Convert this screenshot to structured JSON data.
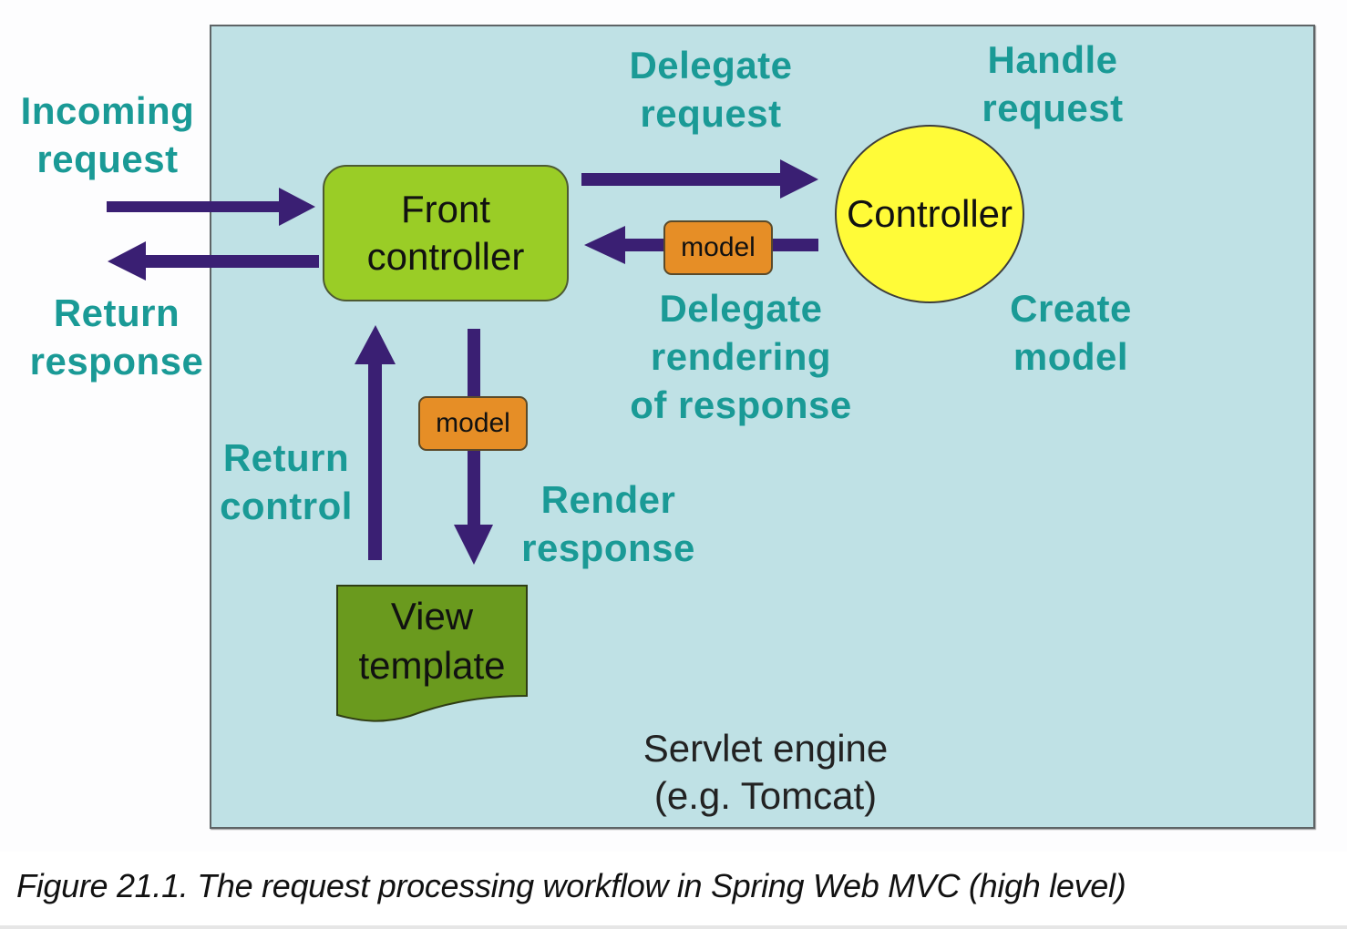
{
  "diagram": {
    "container": {
      "label_line1": "Servlet engine",
      "label_line2": "(e.g. Tomcat)"
    },
    "nodes": {
      "front_controller": {
        "line1": "Front",
        "line2": "controller"
      },
      "controller": {
        "label": "Controller"
      },
      "view_template": {
        "line1": "View",
        "line2": "template"
      },
      "model_badge_horizontal": {
        "label": "model"
      },
      "model_badge_vertical": {
        "label": "model"
      }
    },
    "labels": {
      "incoming_request": {
        "line1": "Incoming",
        "line2": "request"
      },
      "return_response": {
        "line1": "Return",
        "line2": "response"
      },
      "delegate_request": {
        "line1": "Delegate",
        "line2": "request"
      },
      "handle_request": {
        "line1": "Handle",
        "line2": "request"
      },
      "delegate_rendering": {
        "line1": "Delegate",
        "line2": "rendering",
        "line3": "of response"
      },
      "create_model": {
        "line1": "Create",
        "line2": "model"
      },
      "return_control": {
        "line1": "Return",
        "line2": "control"
      },
      "render_response": {
        "line1": "Render",
        "line2": "response"
      }
    },
    "edges": [
      {
        "from": "client",
        "to": "front_controller",
        "label": "Incoming request"
      },
      {
        "from": "front_controller",
        "to": "client",
        "label": "Return response"
      },
      {
        "from": "front_controller",
        "to": "controller",
        "label": "Delegate request"
      },
      {
        "from": "controller",
        "to": "front_controller",
        "label": "Delegate rendering of response",
        "carries": "model"
      },
      {
        "from": "front_controller",
        "to": "view_template",
        "label": "Render response",
        "carries": "model"
      },
      {
        "from": "view_template",
        "to": "front_controller",
        "label": "Return control"
      }
    ],
    "colors": {
      "label_text": "#1a9a96",
      "arrow": "#3a1f73",
      "container_fill": "#bfe1e5",
      "front_controller_fill": "#9acd26",
      "controller_fill": "#fffb38",
      "model_fill": "#e68e26",
      "view_template_fill": "#6a9a1e"
    }
  },
  "caption": "Figure 21.1. The request processing workflow in Spring Web MVC (high level)"
}
